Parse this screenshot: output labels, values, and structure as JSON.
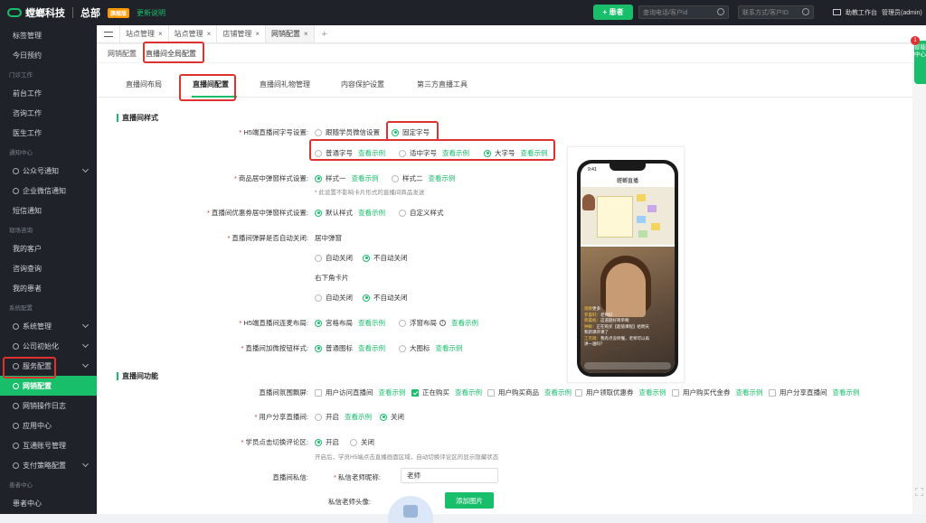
{
  "brand": {
    "name": "螳螂科技",
    "hq": "总部",
    "org_badge": "旗舰版",
    "update": "更新说明"
  },
  "topbar": {
    "add_patient": "+ 患者",
    "search_phone": "查询电话/客户id",
    "search_contact": "联系方式/客户ID",
    "workbench": "助教工作台",
    "user": "管理员(admin)"
  },
  "sidebar": [
    {
      "type": "item",
      "label": "标签管理"
    },
    {
      "type": "item",
      "label": "今日预约"
    },
    {
      "type": "group",
      "label": "门诊工作"
    },
    {
      "type": "item",
      "label": "前台工作"
    },
    {
      "type": "item",
      "label": "咨询工作"
    },
    {
      "type": "item",
      "label": "医生工作"
    },
    {
      "type": "group",
      "label": "通知中心"
    },
    {
      "type": "item",
      "label": "公众号通知",
      "icon": true,
      "chev": true
    },
    {
      "type": "item",
      "label": "企业微信通知",
      "icon": true
    },
    {
      "type": "item",
      "label": "短信通知"
    },
    {
      "type": "group",
      "label": "现场咨询"
    },
    {
      "type": "item",
      "label": "我的客户"
    },
    {
      "type": "item",
      "label": "咨询查询"
    },
    {
      "type": "item",
      "label": "我的患者"
    },
    {
      "type": "group",
      "label": "系统配置"
    },
    {
      "type": "item",
      "label": "系统管理",
      "icon": true,
      "chev": true
    },
    {
      "type": "item",
      "label": "公司初始化",
      "icon": true,
      "chev": true
    },
    {
      "type": "item",
      "label": "服务配置",
      "icon": true,
      "chev": true
    },
    {
      "type": "item",
      "label": "网销配置",
      "icon": true,
      "active": true
    },
    {
      "type": "item",
      "label": "网销操作日志",
      "icon": true
    },
    {
      "type": "item",
      "label": "应用中心",
      "icon": true
    },
    {
      "type": "item",
      "label": "互通账号管理",
      "icon": true
    },
    {
      "type": "item",
      "label": "支付策略配置",
      "icon": true,
      "chev": true
    },
    {
      "type": "group",
      "label": "患者中心"
    },
    {
      "type": "item",
      "label": "患者中心"
    }
  ],
  "tabs": [
    {
      "label": "站点管理",
      "close": "×"
    },
    {
      "label": "站点管理",
      "close": "×"
    },
    {
      "label": "店铺管理",
      "close": "×"
    },
    {
      "label": "网销配置",
      "close": "×",
      "active": true
    }
  ],
  "breadcrumbs": [
    "网销配置",
    "直播间全局配置"
  ],
  "subtabs": [
    "直播间布局",
    "直播间配置",
    "直播间礼物管理",
    "内容保护设置",
    "第三方直播工具"
  ],
  "section1": "直播间样式",
  "section2": "直播间功能",
  "font_setting": {
    "label": "H5端直播间字号设置:",
    "opt_follow": "跟随学员微信设置",
    "opt_fixed": "固定字号"
  },
  "font_sizes": {
    "normal": "普通字号",
    "medium": "适中字号",
    "large": "大字号",
    "example": "查看示例"
  },
  "product_popup": {
    "label": "商品居中弹窗样式设置:",
    "opt1": "样式一",
    "opt2": "样式二",
    "hint": "* 此设置不影响卡片形式的直播间商品发送"
  },
  "coupon_popup": {
    "label": "直播间优惠券居中弹窗样式设置:",
    "opt1": "默认样式",
    "opt2": "自定义样式"
  },
  "auto_close": {
    "label": "直播间弹屏是否自动关闭:",
    "center": "居中弹窗",
    "corner": "右下角卡片",
    "on": "自动关闭",
    "off": "不自动关闭"
  },
  "mic_layout": {
    "label": "H5端直播间连麦布局:",
    "opt1": "宫格布局",
    "opt2": "浮窗布局"
  },
  "wechat_btn": {
    "label": "直播间加微按钮样式:",
    "opt1": "普通图标",
    "opt2": "大图标"
  },
  "atmosphere": {
    "label": "直播间氛围飘屏:",
    "items": [
      "用户访问直播间",
      "正在购买",
      "用户购买商品",
      "用户领取优惠券",
      "用户购买代金券",
      "用户分享直播间"
    ]
  },
  "share": {
    "label": "用户分享直播间:",
    "on": "开启",
    "off": "关闭"
  },
  "comment_switch": {
    "label": "学员点击切换评论区:",
    "on": "开启",
    "off": "关闭",
    "hint": "开启后，学员H5端点击直播画面区域，自动切换评论区的显示隐藏状态"
  },
  "private_msg": {
    "label": "直播间私信:",
    "nick_label": "私信老师昵称:",
    "nick_value": "老师",
    "avatar_label": "私信老师头像:",
    "add_image": "添加图片"
  },
  "preview": {
    "time": "9:41",
    "title": "螳螂直播",
    "chat": [
      [
        "观察",
        "更多"
      ],
      [
        "罗晨轩：",
        "老师好"
      ],
      [
        "郭晨帆：",
        "这道题好简单啊"
      ],
      [
        "钟颖：",
        "正在购买【超值课程】给明天和新课开课了"
      ],
      [
        "江杰薇：",
        "我有点没听懂，老师可以再讲一遍吗？"
      ]
    ]
  },
  "right_widget": {
    "text": "智能中心",
    "count": "1"
  }
}
